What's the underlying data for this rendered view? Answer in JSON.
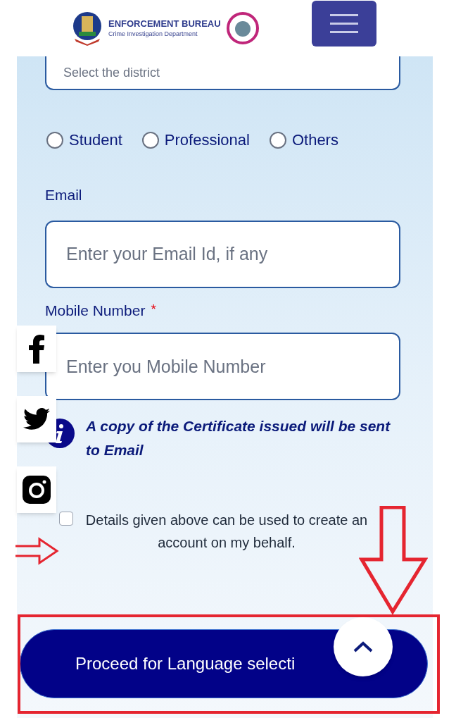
{
  "header": {
    "title": "ENFORCEMENT BUREAU",
    "subtitle": "Crime Investigation Department"
  },
  "district_field": {
    "placeholder": "Select the district"
  },
  "occupation_options": [
    {
      "label": "Student",
      "selected": false
    },
    {
      "label": "Professional",
      "selected": false
    },
    {
      "label": "Others",
      "selected": false
    }
  ],
  "email": {
    "label": "Email",
    "placeholder": "Enter your Email Id, if any"
  },
  "mobile": {
    "label": "Mobile Number",
    "required_mark": "*",
    "placeholder": "Enter you Mobile Number"
  },
  "info_note": "A copy of the Certificate issued will be sent to Email",
  "consent": {
    "text": "Details given above can be used to create an account on my behalf.",
    "checked": false
  },
  "submit_button": "Proceed for Language selecti",
  "social_links": [
    {
      "kind": "facebook"
    },
    {
      "kind": "twitter"
    },
    {
      "kind": "instagram"
    }
  ]
}
